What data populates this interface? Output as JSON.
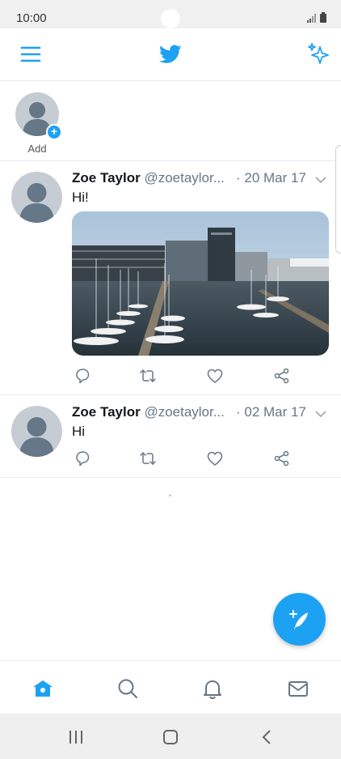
{
  "status": {
    "time": "10:00"
  },
  "header": {
    "menu_icon": "hamburger-icon",
    "logo_icon": "twitter-bird-icon",
    "sparkle_icon": "sparkle-icon",
    "accent": "#1da1f2"
  },
  "fleets": {
    "add_label": "Add"
  },
  "tweets": [
    {
      "name": "Zoe Taylor",
      "handle": "@zoetaylor...",
      "date": "· 20 Mar 17",
      "text": "Hi!",
      "has_photo": true
    },
    {
      "name": "Zoe Taylor",
      "handle": "@zoetaylor...",
      "date": "· 02 Mar 17",
      "text": "Hi",
      "has_photo": false
    }
  ],
  "actions": [
    "reply-icon",
    "retweet-icon",
    "like-icon",
    "share-icon"
  ],
  "bottom_nav": [
    "home-icon",
    "search-icon",
    "notifications-icon",
    "messages-icon"
  ],
  "system_nav": [
    "recent-apps-icon",
    "home-button-icon",
    "back-icon"
  ]
}
